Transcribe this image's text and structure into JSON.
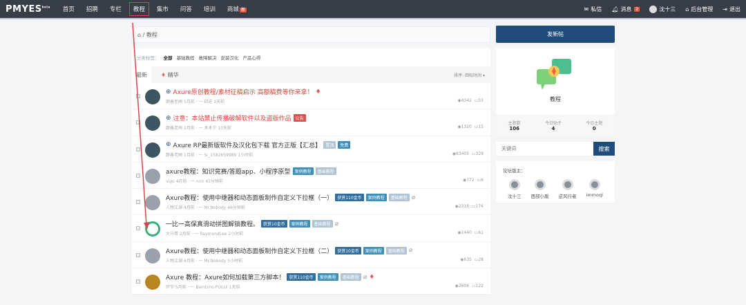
{
  "nav": {
    "logo": "PMYES",
    "logo_sup": "beta",
    "items": [
      "首页",
      "招聘",
      "专栏",
      "教程",
      "集市",
      "问答",
      "培训",
      "商城"
    ],
    "shop_badge": "新",
    "right": {
      "messages": "私信",
      "notices": "消息",
      "notice_count": "2",
      "user": "沈十三",
      "admin": "后台管理",
      "logout": "退出"
    }
  },
  "breadcrumb": {
    "home": "⌂",
    "current": "教程"
  },
  "filters": {
    "label": "分类标签：",
    "items": [
      "全部",
      "基础教程",
      "故障解决",
      "安装汉化",
      "产品心得"
    ]
  },
  "tabs": {
    "latest": "最新",
    "featured": "精华",
    "sort": "排序: 回帖时间 ▾"
  },
  "posts": [
    {
      "title": "Axure原创教程/素材征稿启示 高额稿费等你来拿！",
      "red": true,
      "pin": true,
      "tags": [],
      "gem": true,
      "meta": "颠善老闸  5月前  ·  一  印迹  1天前",
      "views": "4342",
      "replies": "53"
    },
    {
      "title": "注意：本站禁止传播破解软件以及盗版作品",
      "red": true,
      "pin": true,
      "tags": [
        {
          "t": "公告",
          "c": "red"
        }
      ],
      "meta": "颠善老闸  2月前  ·  一  木术夕  13天前",
      "views": "1320",
      "replies": "15"
    },
    {
      "title": "Axure RP最新版软件及汉化包下载 官方正版【汇总】",
      "pin": true,
      "tags": [
        {
          "t": "置顶",
          "c": "gray"
        },
        {
          "t": "免费",
          "c": "teal"
        }
      ],
      "meta": "颠善老闸  1月前  ·  一  Sι_15826S9989  1小时前",
      "views": "83405",
      "replies": "329"
    },
    {
      "title": "axure教程：知识竞赛/答题app、小程序原型",
      "tags": [
        {
          "t": "案例教程",
          "c": "teal"
        },
        {
          "t": "基础教程",
          "c": "gray"
        }
      ],
      "meta": "vigo  4月前  ·  一  nnn  45分钟前",
      "views": "772",
      "replies": "6"
    },
    {
      "title": "Axure教程：使用中继器和动态面板制作自定义下拉框（一）",
      "tags": [
        {
          "t": "获赏110金币",
          "c": "dark"
        },
        {
          "t": "案例教程",
          "c": "teal"
        },
        {
          "t": "基础教程",
          "c": "gray"
        }
      ],
      "clip": true,
      "meta": "人物江湖  4月前  ·  一  Mr.Nobody  46分钟前",
      "views": "2316",
      "replies": "176"
    },
    {
      "title": "一比一高保真滑动拼图解锁教程。",
      "tags": [
        {
          "t": "获赏10金币",
          "c": "dark"
        },
        {
          "t": "案例教程",
          "c": "teal"
        },
        {
          "t": "基础教程",
          "c": "gray"
        }
      ],
      "clip": true,
      "meta": "大马哥  2月前  ·  一  RaymondLee  2小时前",
      "views": "1440",
      "replies": "61"
    },
    {
      "title": "Axure教程：使用中继器和动态面板制作自定义下拉框（二）",
      "tags": [
        {
          "t": "获赏10金币",
          "c": "dark"
        },
        {
          "t": "案例教程",
          "c": "teal"
        },
        {
          "t": "基础教程",
          "c": "gray"
        }
      ],
      "clip": true,
      "meta": "人物江湖  4月前  ·  一  Mr.Nobody  5小时前",
      "views": "635",
      "replies": "28"
    },
    {
      "title": "Axure 教程：Axure如何加载第三方脚本！",
      "tags": [
        {
          "t": "获赏110金币",
          "c": "dark"
        },
        {
          "t": "案例教程",
          "c": "teal"
        },
        {
          "t": "基础教程",
          "c": "gray"
        }
      ],
      "clip": true,
      "gem": true,
      "meta": "环节  5月前  ·  一  Bambino.POLLY  1天前",
      "views": "2606",
      "replies": "122"
    }
  ],
  "sidebar": {
    "new_post": "发新帖",
    "forum_name": "教程",
    "counts": [
      {
        "label": "主题数",
        "value": "106"
      },
      {
        "label": "今日贴子",
        "value": "4"
      },
      {
        "label": "今日主题",
        "value": "0"
      }
    ],
    "search_placeholder": "关键词",
    "search_btn": "搜索",
    "mods_label": "论坛版主：",
    "mods": [
      "沈十三",
      "西部小盾",
      "逆风行者",
      "immoql"
    ]
  },
  "colors": {
    "nav": "#373c49",
    "primary": "#1f4c7b",
    "annotation": "#d9434b"
  }
}
